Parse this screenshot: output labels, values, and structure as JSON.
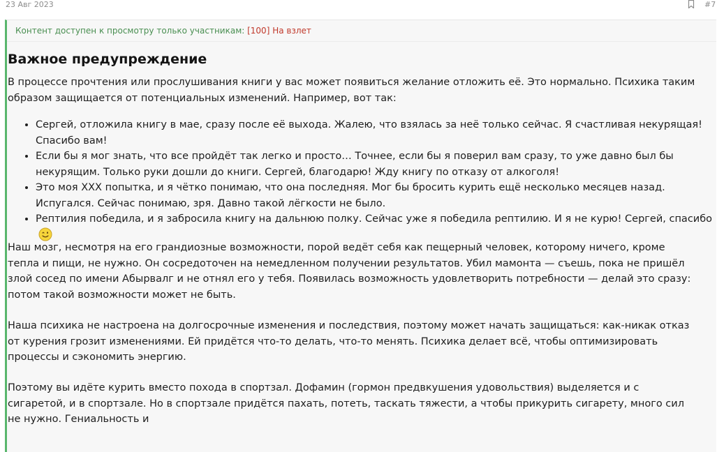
{
  "post": {
    "date": "23 Авг 2023",
    "number": "#7"
  },
  "access": {
    "notice": "Контент доступен к просмотру только участникам: ",
    "group": "[100] На взлет"
  },
  "article": {
    "heading": "Важное предупреждение",
    "intro": "В процессе прочтения или прослушивания книги у вас может появиться желание отложить её. Это нормально. Психика таким образом защищается от потенциальных изменений. Например, вот так:",
    "quotes": [
      "Сергей, отложила книгу в мае, сразу после её выхода. Жалею, что взялась за неё только сейчас. Я счастливая некурящая! Спасибо вам!",
      "Если бы я мог знать, что все пройдёт так легко и просто… Точнее, если бы я поверил вам сразу, то уже давно был бы некурящим. Только руки дошли до книги. Сергей, благодарю! Жду книгу по отказу от алкоголя!",
      "Это моя XXX попытка, и я чётко понимаю, что она последняя. Мог бы бросить курить ещё несколько месяцев назад. Испугался. Сейчас понимаю, зря. Давно такой лёгкости не было.",
      "Рептилия победила, и я забросила книгу на дальнюю полку. Сейчас уже я победила рептилию. И я не курю! Сергей, спасибо"
    ],
    "paragraph2": "Наш мозг, несмотря на его грандиозные возможности, порой ведёт себя как пещерный человек, которому ничего, кроме тепла и пищи, не нужно. Он сосредоточен на немедленном получении результатов. Убил мамонта — съешь, пока не пришёл злой сосед по имени Абырвалг и не отнял его у тебя. Появилась возможность удовлетворить потребности — делай это сразу: потом такой возможности может не быть.",
    "paragraph3": "Наша психика не настроена на долгосрочные изменения и последствия, поэтому может начать защищаться: как-никак отказ от курения грозит изменениями. Ей придётся что-то делать, что-то менять. Психика делает всё, чтобы оптимизировать процессы и сэкономить энергию.",
    "paragraph4": "Поэтому вы идёте курить вместо похода в спортзал. Дофамин (гормон предвкушения удовольствия) выделяется и с сигаретой, и в спортзале. Но в спортзале придётся пахать, потеть, таскать тяжести, а чтобы прикурить сигарету, много сил не нужно. Гениальность и"
  },
  "icons": {
    "bookmark": "bookmark-icon",
    "smile": "smile-wink-icon"
  },
  "colors": {
    "accent_border": "#59b66d",
    "notice_text": "#4a8f52",
    "group_link": "#c0392b",
    "block_bg": "#f7f7f7"
  }
}
